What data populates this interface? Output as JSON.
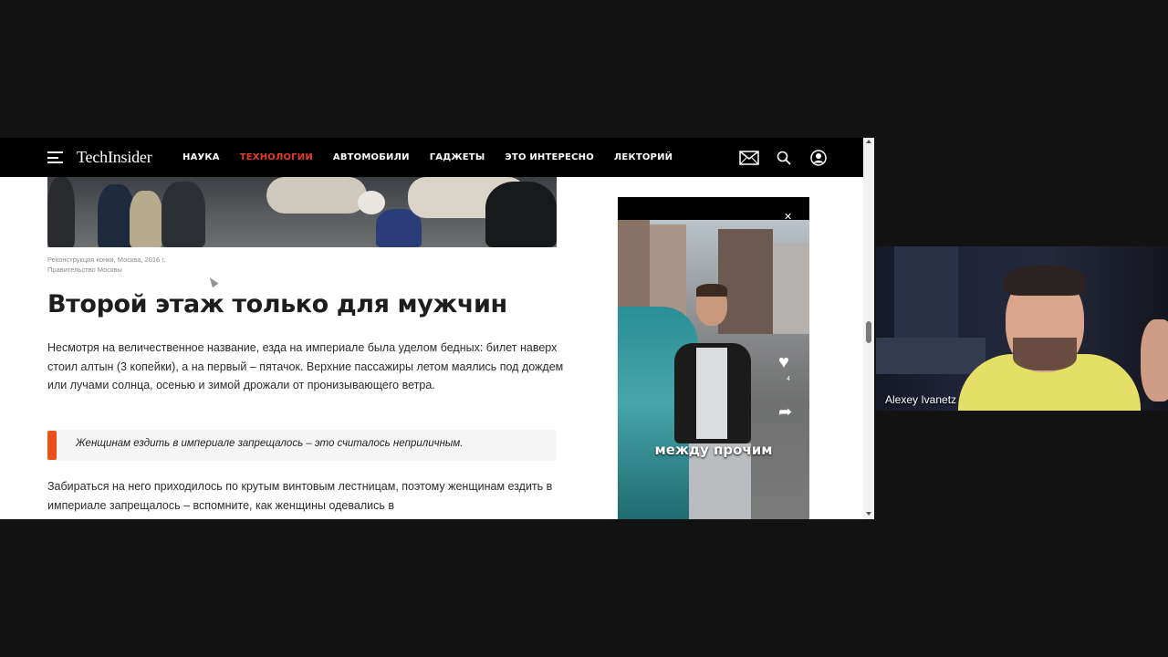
{
  "site": {
    "logo": "TechInsider",
    "nav": [
      "НАУКА",
      "ТЕХНОЛОГИИ",
      "АВТОМОБИЛИ",
      "ГАДЖЕТЫ",
      "ЭТО ИНТЕРЕСНО",
      "ЛЕКТОРИЙ"
    ],
    "active_nav": "ТЕХНОЛОГИИ",
    "icons": [
      "mail-icon",
      "search-icon",
      "user-icon"
    ]
  },
  "article": {
    "caption_line1": "Реконструкция конки, Москва, 2016 г.",
    "caption_line2": "Правительство Москвы",
    "heading": "Второй этаж только для мужчин",
    "paragraph1": "Несмотря на величественное название, езда на империале была уделом бедных: билет наверх стоил алтын (3 копейки), а на первый – пятачок. Верхние пассажиры летом маялись под дождем или лучами солнца, осенью и зимой дрожали от пронизывающего ветра.",
    "quote": "Женщинам ездить в империале запрещалось – это считалось неприличным.",
    "paragraph2": "Забираться на него приходилось по крутым винтовым лестницам, поэтому женщинам ездить в империале запрещалось – вспомните, как женщины одевались в"
  },
  "ad": {
    "caption": "между прочим",
    "like_count": "4"
  },
  "webcam": {
    "participant_name": "Alexey Ivanetz"
  },
  "colors": {
    "accent": "#e63a2e",
    "quote_bar": "#e8511c",
    "nav_bg": "#000000"
  }
}
